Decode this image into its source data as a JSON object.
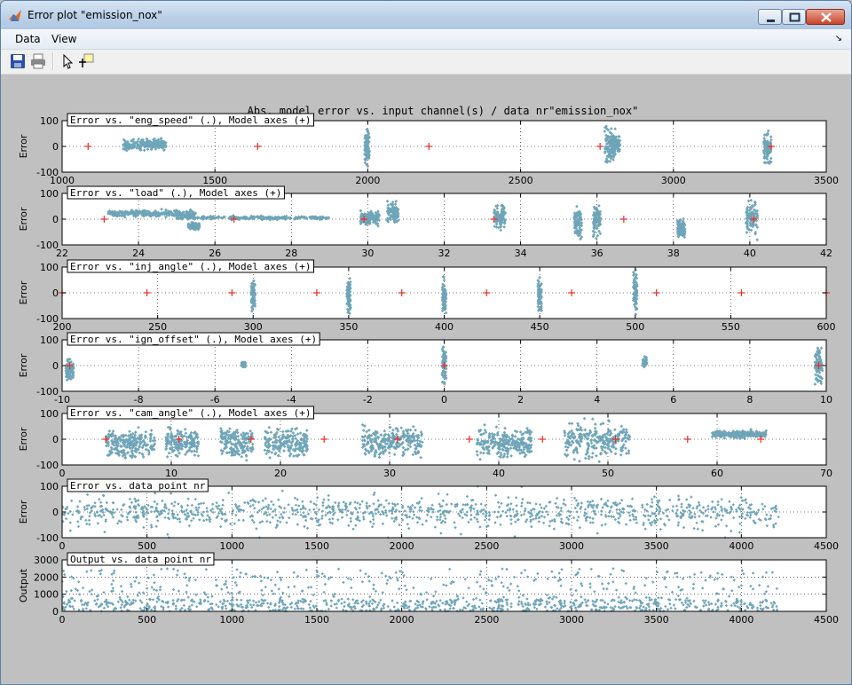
{
  "window": {
    "title": "Error plot \"emission_nox\"",
    "menu": [
      "Data",
      "View"
    ],
    "toolbar": [
      "save-icon",
      "print-icon",
      "pointer-icon",
      "data-cursor-icon"
    ]
  },
  "figure_title": "Abs. model error vs. input channel(s) / data nr\"emission_nox\"",
  "colors": {
    "points": "#6fa5b8",
    "model_axes": "#e8302a",
    "grid": "#000000"
  },
  "chart_data": [
    {
      "type": "scatter",
      "legend": "Error vs. \"eng_speed\" (.), Model axes (+)",
      "ylabel": "Error",
      "xlim": [
        1000,
        3500
      ],
      "ylim": [
        -100,
        100
      ],
      "xticks": [
        1000,
        1500,
        2000,
        2500,
        3000,
        3500
      ],
      "yticks": [
        -100,
        0,
        100
      ],
      "model_axes": [
        1085,
        1640,
        2200,
        2760,
        3320
      ],
      "clusters": [
        {
          "x": [
            1200,
            1340
          ],
          "y": [
            -20,
            35
          ]
        },
        {
          "x": [
            1990,
            2005
          ],
          "y": [
            -90,
            80
          ]
        },
        {
          "x": [
            2775,
            2810
          ],
          "y": [
            -90,
            90
          ]
        },
        {
          "x": [
            2790,
            2825
          ],
          "y": [
            -50,
            60
          ]
        },
        {
          "x": [
            3295,
            3320
          ],
          "y": [
            -90,
            80
          ]
        }
      ]
    },
    {
      "type": "scatter",
      "legend": "Error vs. \"load\" (.), Model axes (+)",
      "ylabel": "Error",
      "xlim": [
        22,
        42
      ],
      "ylim": [
        -100,
        100
      ],
      "xticks": [
        22,
        24,
        26,
        28,
        30,
        32,
        34,
        36,
        38,
        40,
        42
      ],
      "yticks": [
        -100,
        0,
        100
      ],
      "model_axes": [
        23.1,
        26.5,
        29.9,
        33.3,
        36.7,
        40.1
      ],
      "clusters": [
        {
          "x": [
            23.2,
            25.5
          ],
          "y": [
            5,
            40
          ]
        },
        {
          "x": [
            25,
            29
          ],
          "y": [
            -5,
            15
          ]
        },
        {
          "x": [
            25.3,
            25.6
          ],
          "y": [
            -45,
            -10
          ]
        },
        {
          "x": [
            29.8,
            30.3
          ],
          "y": [
            -30,
            40
          ]
        },
        {
          "x": [
            30.5,
            30.8
          ],
          "y": [
            -30,
            80
          ]
        },
        {
          "x": [
            33.3,
            33.6
          ],
          "y": [
            -60,
            80
          ]
        },
        {
          "x": [
            35.4,
            35.6
          ],
          "y": [
            -90,
            70
          ]
        },
        {
          "x": [
            35.9,
            36.1
          ],
          "y": [
            -90,
            80
          ]
        },
        {
          "x": [
            38.1,
            38.3
          ],
          "y": [
            -90,
            20
          ]
        },
        {
          "x": [
            39.9,
            40.2
          ],
          "y": [
            -90,
            100
          ]
        }
      ]
    },
    {
      "type": "scatter",
      "legend": "Error vs. \"inj_angle\" (.), Model axes (+)",
      "ylabel": "Error",
      "xlim": [
        200,
        600
      ],
      "ylim": [
        -100,
        100
      ],
      "xticks": [
        200,
        250,
        300,
        350,
        400,
        450,
        500,
        550,
        600
      ],
      "yticks": [
        -100,
        0,
        100
      ],
      "model_axes": [
        200,
        244.4,
        288.9,
        333.3,
        377.8,
        422.2,
        466.7,
        511.1,
        555.6,
        600
      ],
      "clusters": [
        {
          "x": [
            299,
            301
          ],
          "y": [
            -100,
            70
          ]
        },
        {
          "x": [
            349,
            351
          ],
          "y": [
            -100,
            80
          ]
        },
        {
          "x": [
            399,
            401
          ],
          "y": [
            -100,
            80
          ]
        },
        {
          "x": [
            449,
            451
          ],
          "y": [
            -100,
            80
          ]
        },
        {
          "x": [
            499,
            501
          ],
          "y": [
            -100,
            100
          ]
        }
      ]
    },
    {
      "type": "scatter",
      "legend": "Error vs. \"ign_offset\" (.), Model axes (+)",
      "ylabel": "Error",
      "xlim": [
        -10,
        10
      ],
      "ylim": [
        -100,
        100
      ],
      "xticks": [
        -10,
        -8,
        -6,
        -4,
        -2,
        0,
        2,
        4,
        6,
        8,
        10
      ],
      "yticks": [
        -100,
        0,
        100
      ],
      "model_axes": [
        -9.8,
        0,
        9.8
      ],
      "clusters": [
        {
          "x": [
            -9.9,
            -9.7
          ],
          "y": [
            -80,
            40
          ]
        },
        {
          "x": [
            -5.3,
            -5.2
          ],
          "y": [
            -10,
            20
          ]
        },
        {
          "x": [
            -0.05,
            0.05
          ],
          "y": [
            -90,
            90
          ]
        },
        {
          "x": [
            5.2,
            5.3
          ],
          "y": [
            -10,
            40
          ]
        },
        {
          "x": [
            9.7,
            9.9
          ],
          "y": [
            -100,
            100
          ]
        }
      ]
    },
    {
      "type": "scatter",
      "legend": "Error vs. \"cam_angle\" (.), Model axes (+)",
      "ylabel": "Error",
      "xlim": [
        0,
        70
      ],
      "ylim": [
        -100,
        100
      ],
      "xticks": [
        0,
        10,
        20,
        30,
        40,
        50,
        60,
        70
      ],
      "yticks": [
        -100,
        0,
        100
      ],
      "model_axes": [
        4,
        10.7,
        17.3,
        24,
        30.7,
        37.3,
        44,
        50.7,
        57.3,
        64
      ],
      "clusters": [
        {
          "x": [
            4,
            8.5
          ],
          "y": [
            -90,
            60
          ]
        },
        {
          "x": [
            9.5,
            12.5
          ],
          "y": [
            -90,
            60
          ]
        },
        {
          "x": [
            14.5,
            17.5
          ],
          "y": [
            -90,
            70
          ]
        },
        {
          "x": [
            18.5,
            22.5
          ],
          "y": [
            -90,
            60
          ]
        },
        {
          "x": [
            27.5,
            33
          ],
          "y": [
            -90,
            70
          ]
        },
        {
          "x": [
            38,
            43
          ],
          "y": [
            -90,
            60
          ]
        },
        {
          "x": [
            46,
            52
          ],
          "y": [
            -100,
            90
          ]
        },
        {
          "x": [
            59.5,
            64.5
          ],
          "y": [
            0,
            40
          ]
        }
      ]
    },
    {
      "type": "scatter",
      "legend": "Error vs. data point nr",
      "ylabel": "Error",
      "xlim": [
        0,
        4500
      ],
      "ylim": [
        -100,
        100
      ],
      "xticks": [
        0,
        500,
        1000,
        1500,
        2000,
        2500,
        3000,
        3500,
        4000,
        4500
      ],
      "yticks": [
        -100,
        0,
        100
      ],
      "n_points": 4220
    },
    {
      "type": "scatter",
      "legend": "Output vs. data point nr",
      "ylabel": "Output",
      "xlim": [
        0,
        4500
      ],
      "ylim": [
        0,
        3000
      ],
      "xticks": [
        0,
        500,
        1000,
        1500,
        2000,
        2500,
        3000,
        3500,
        4000,
        4500
      ],
      "yticks": [
        0,
        1000,
        2000,
        3000
      ],
      "n_points": 4220
    }
  ]
}
